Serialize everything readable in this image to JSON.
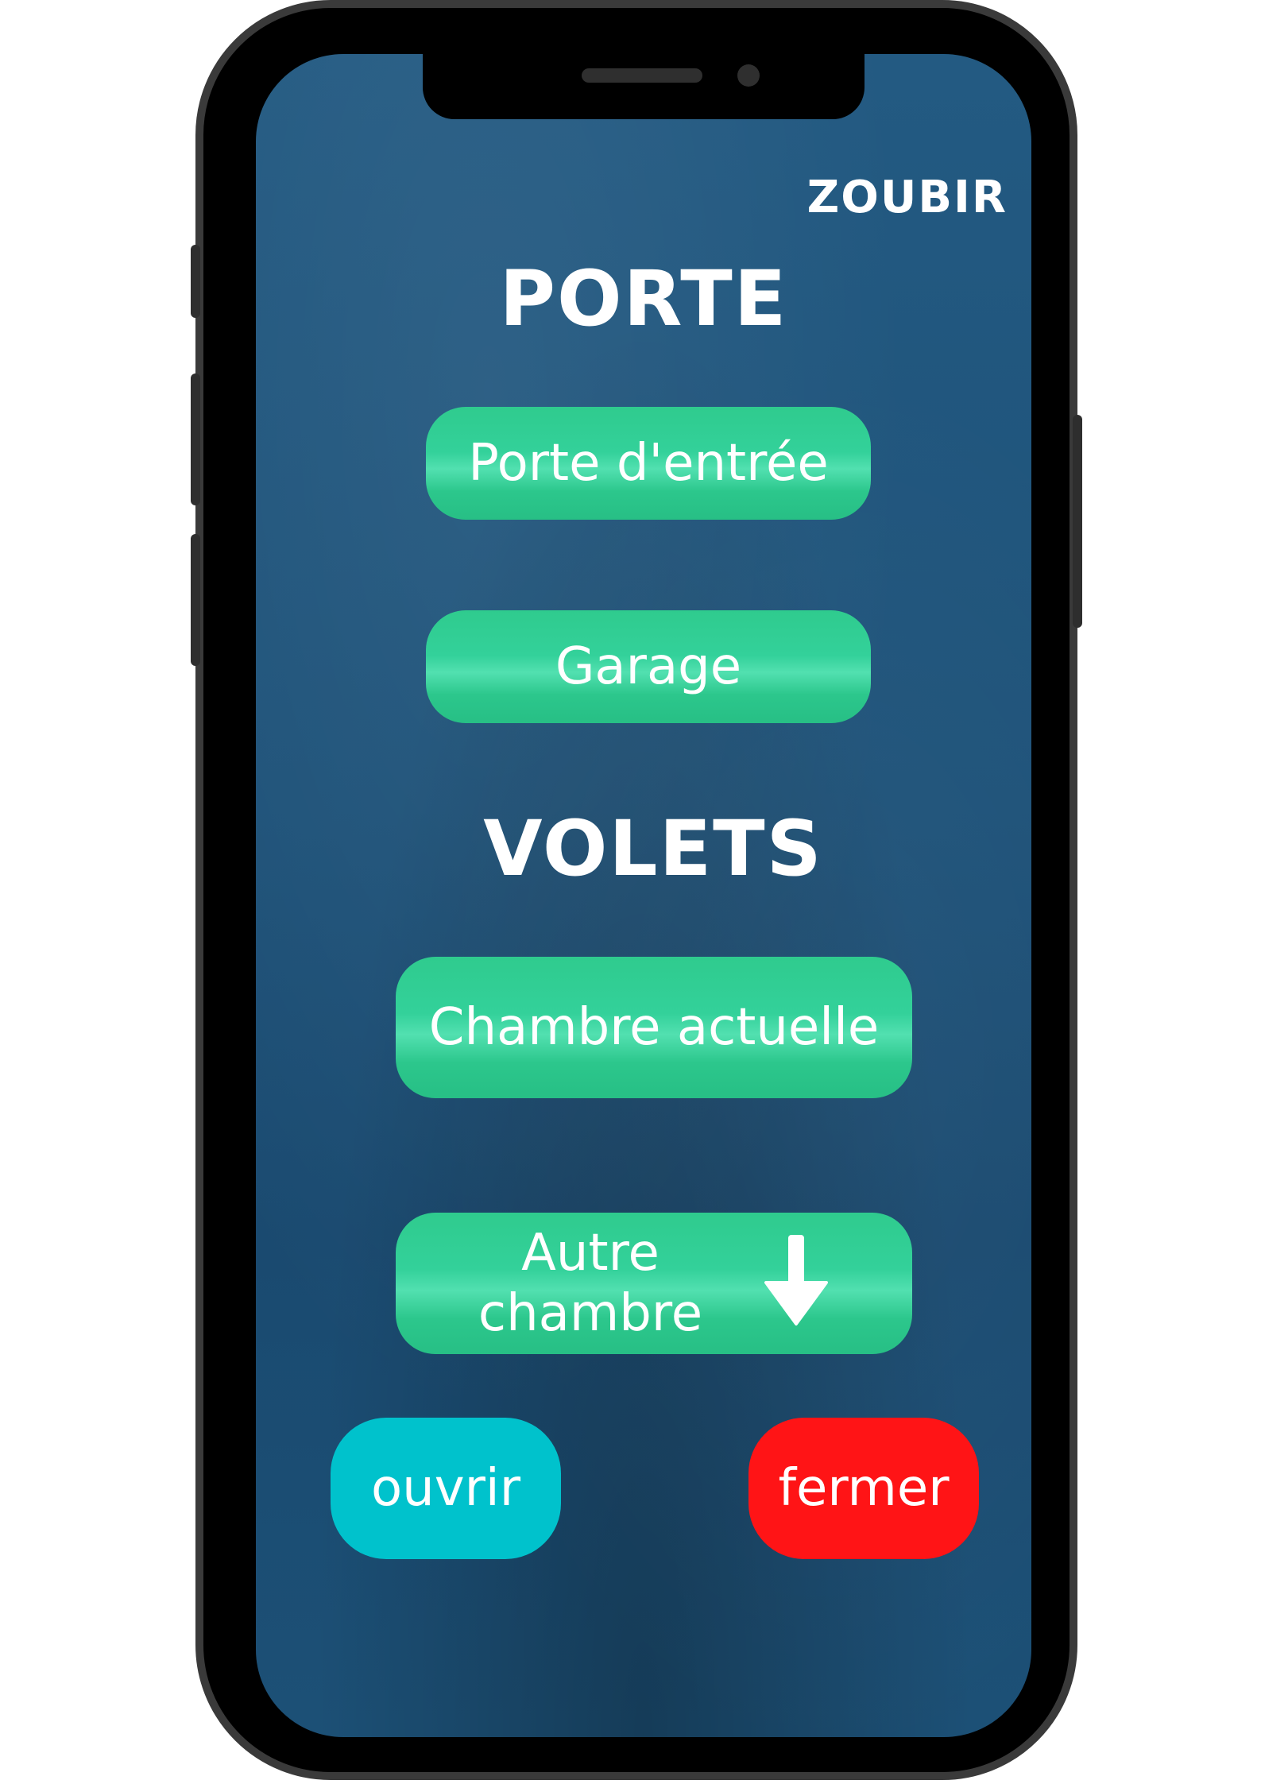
{
  "header": {
    "user_name": "ZOUBIR"
  },
  "porte": {
    "title": "PORTE",
    "buttons": [
      "Porte d'entrée",
      "Garage"
    ]
  },
  "volets": {
    "title": "VOLETS",
    "current_room_label": "Chambre actuelle",
    "other_room_line1": "Autre",
    "other_room_line2": "chambre",
    "other_room_icon": "arrow-down-icon"
  },
  "actions": {
    "open_label": "ouvrir",
    "close_label": "fermer",
    "open_color": "#00c2cc",
    "close_color": "#ff1416",
    "accent_green": "#33d19a",
    "background": "#1e5279"
  }
}
